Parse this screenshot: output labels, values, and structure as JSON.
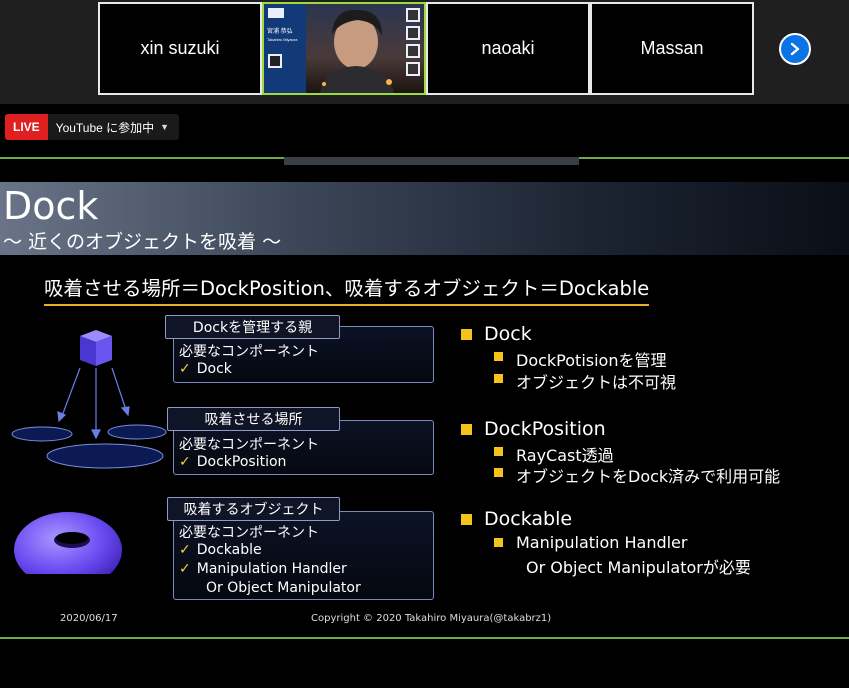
{
  "participants": [
    {
      "name": "xin suzuki"
    },
    {
      "name": "naoaki"
    },
    {
      "name": "Massan"
    }
  ],
  "video_tile": {
    "lines": [
      "宮浦 恭弘",
      "Takahiro Miyaura"
    ]
  },
  "live": {
    "badge": "LIVE",
    "text": "YouTube に参加中"
  },
  "slide": {
    "title": "Dock",
    "subtitle": "〜 近くのオブジェクトを吸着 〜",
    "headline": "吸着させる場所＝DockPosition、吸着するオブジェクト＝Dockable",
    "boxes": [
      {
        "label": "Dockを管理する親",
        "lines": [
          "必要なコンポーネント",
          "Dock"
        ]
      },
      {
        "label": "吸着させる場所",
        "lines": [
          "必要なコンポーネント",
          "DockPosition"
        ]
      },
      {
        "label": "吸着するオブジェクト",
        "lines": [
          "必要なコンポーネント",
          "Dockable",
          "Manipulation Handler",
          "Or Object Manipulator"
        ]
      }
    ],
    "bullets": [
      {
        "title": "Dock",
        "subs": [
          "DockPotisionを管理",
          "オブジェクトは不可視"
        ]
      },
      {
        "title": "DockPosition",
        "subs": [
          "RayCast透過",
          "オブジェクトをDock済みで利用可能"
        ]
      },
      {
        "title": "Dockable",
        "subs": [
          "Manipulation Handler",
          "Or Object Manipulatorが必要"
        ]
      }
    ],
    "footer_date": "2020/06/17",
    "footer_copyright": "Copyright © 2020 Takahiro Miyaura(@takabrz1)"
  },
  "colors": {
    "accent_green": "#6fa84a",
    "bullet_yellow": "#f3c419",
    "live_red": "#e02020",
    "next_blue": "#0b74e5"
  },
  "icons": {
    "next": "chevron-right-icon",
    "caret": "caret-down-icon"
  }
}
